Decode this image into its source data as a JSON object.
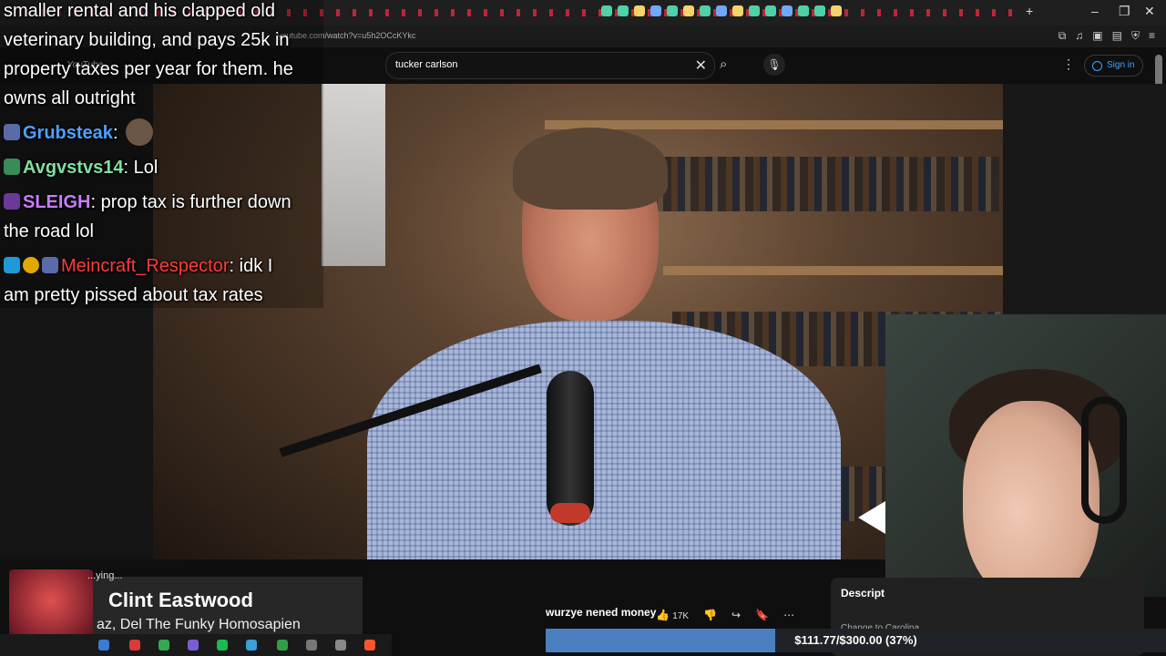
{
  "browser": {
    "url": "youtube.com/watch?v=u5h2OCcKYkc",
    "window_controls": {
      "minimize": "–",
      "maximize": "❐",
      "close": "✕"
    },
    "new_tab": "+"
  },
  "youtube": {
    "logo_text": "YouTube",
    "search": {
      "query": "tucker carlson",
      "clear_glyph": "✕",
      "search_glyph": "⌕",
      "mic_glyph": "🎙"
    },
    "menu_glyph": "⋮",
    "sign_in": "Sign in"
  },
  "chat": [
    {
      "user": "",
      "text": "smaller rental and his clapped old"
    },
    {
      "user": "",
      "text": "veterinary building, and pays 25k in"
    },
    {
      "user": "",
      "text": "property taxes per year for them. he"
    },
    {
      "user": "",
      "text": "owns all outright"
    },
    {
      "user": "Grubsteak",
      "text": ":"
    },
    {
      "user": "Avgvstvs14",
      "text": ": Lol"
    },
    {
      "user": "SLEIGH",
      "text": ": prop tax is further down"
    },
    {
      "user": "",
      "text": "the road lol"
    },
    {
      "user": "Meincraft_Respector",
      "text": ": idk I"
    },
    {
      "user": "",
      "text": "am pretty pissed about tax rates"
    }
  ],
  "now_playing": {
    "label": "...ying...",
    "title": "Clint Eastwood",
    "artist": "az, Del The Funky Homosapien"
  },
  "video_actions": {
    "likes": "17K",
    "like_glyph": "👍",
    "dislike_glyph": "👎",
    "share_glyph": "↪",
    "save_glyph": "🔖",
    "more_glyph": "⋯"
  },
  "description": {
    "title": "Descript",
    "sub": "Change to Carolina"
  },
  "goal": {
    "message": "wurzye nened money",
    "text": "$111.77/$300.00 (37%)",
    "progress": 0.37
  },
  "colors": {
    "accent": "#3ea6ff",
    "goal_fill": "#4a7fc0",
    "grubsteak": "#4aa3ff",
    "avgvstvs14": "#7ee0a0",
    "sleigh": "#c77dff",
    "meincraft": "#ff3b3b"
  }
}
